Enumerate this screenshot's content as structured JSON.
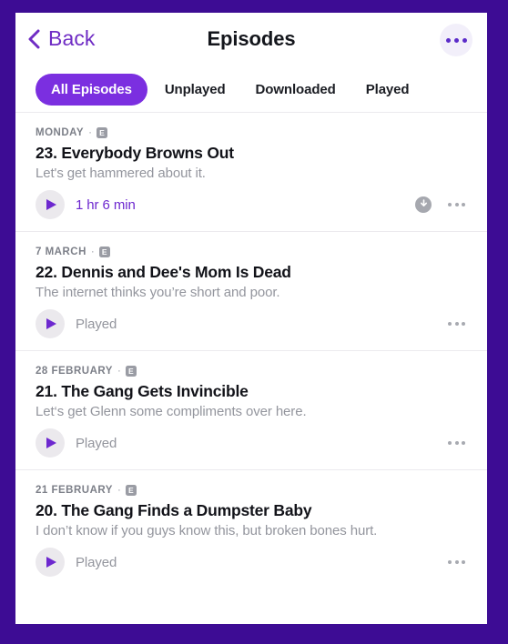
{
  "header": {
    "back_label": "Back",
    "title": "Episodes",
    "back_icon": "chevron-left-icon",
    "overflow_icon": "ellipsis-icon"
  },
  "tabs": [
    {
      "label": "All Episodes",
      "active": true
    },
    {
      "label": "Unplayed",
      "active": false
    },
    {
      "label": "Downloaded",
      "active": false
    },
    {
      "label": "Played",
      "active": false
    }
  ],
  "colors": {
    "frame": "#3d0c94",
    "accent": "#7b2fe0",
    "back_link": "#6f2cc4",
    "play_glyph": "#6d28cf",
    "muted_text": "#93959d",
    "meta_text": "#7c7f88",
    "card": "#ffffff"
  },
  "episodes": [
    {
      "date": "MONDAY",
      "separator": "·",
      "explicit_badge": "E",
      "title": "23. Everybody Browns Out",
      "description": "Let's get hammered about it.",
      "status": "1 hr 6 min",
      "status_kind": "duration",
      "has_download": true,
      "play_icon": "play-icon",
      "download_icon": "download-icon",
      "more_icon": "ellipsis-icon"
    },
    {
      "date": "7 MARCH",
      "separator": "·",
      "explicit_badge": "E",
      "title": "22. Dennis and Dee's Mom Is Dead",
      "description": "The internet thinks you’re short and poor.",
      "status": "Played",
      "status_kind": "played",
      "has_download": false,
      "play_icon": "play-icon",
      "more_icon": "ellipsis-icon"
    },
    {
      "date": "28 FEBRUARY",
      "separator": "·",
      "explicit_badge": "E",
      "title": "21. The Gang Gets Invincible",
      "description": "Let‘s get Glenn some compliments over here.",
      "status": "Played",
      "status_kind": "played",
      "has_download": false,
      "play_icon": "play-icon",
      "more_icon": "ellipsis-icon"
    },
    {
      "date": "21 FEBRUARY",
      "separator": "·",
      "explicit_badge": "E",
      "title": "20. The Gang Finds a Dumpster Baby",
      "description": "I don’t know if you guys know this, but broken bones hurt.",
      "status": "Played",
      "status_kind": "played",
      "has_download": false,
      "play_icon": "play-icon",
      "more_icon": "ellipsis-icon"
    }
  ]
}
